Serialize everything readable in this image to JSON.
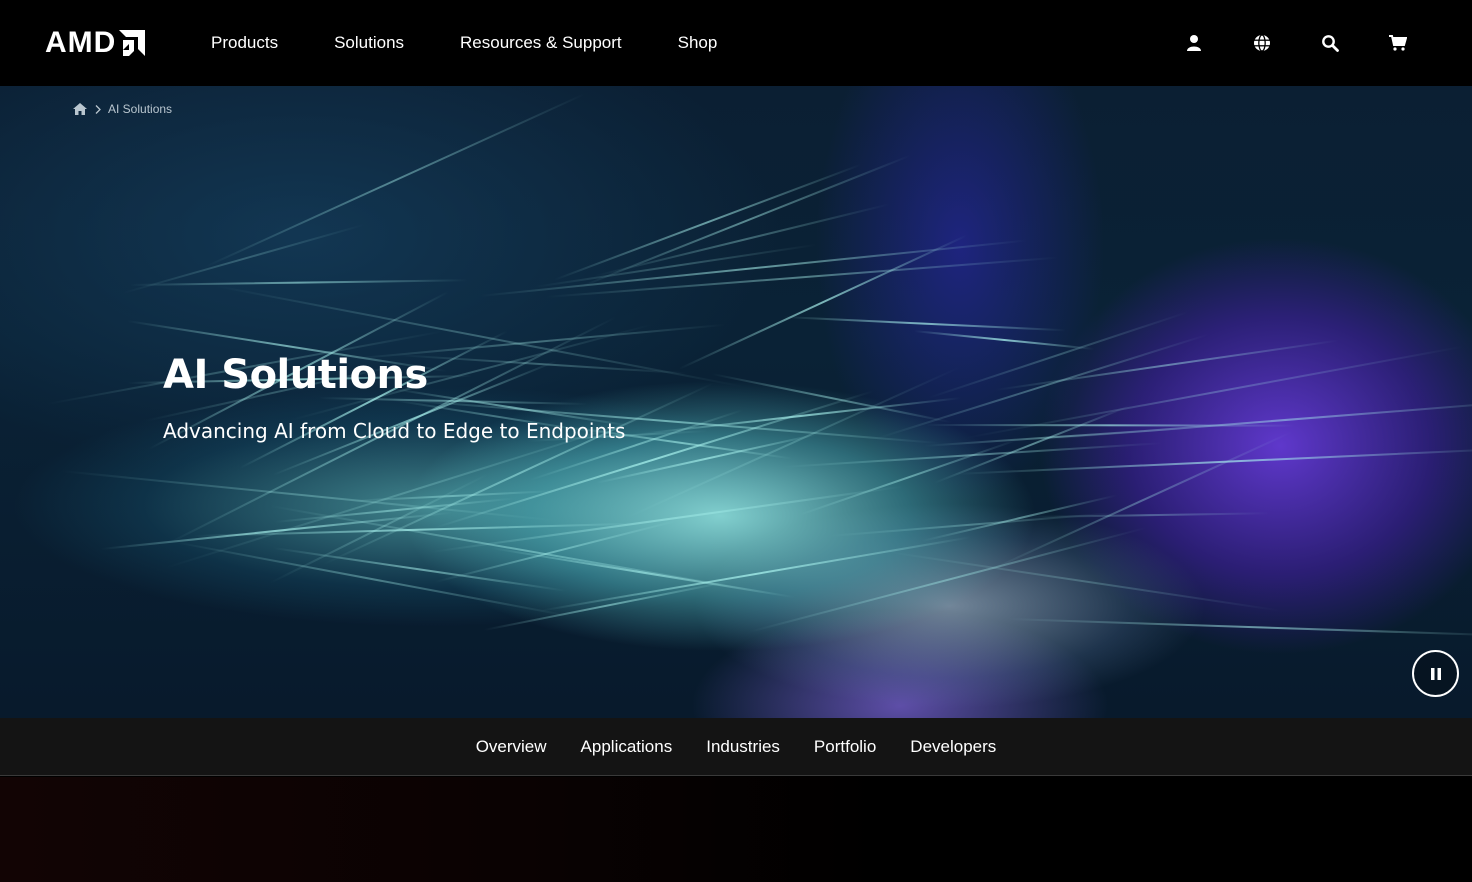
{
  "brand": {
    "logo_text": "AMD",
    "accent": "#ffffff"
  },
  "nav": {
    "links": [
      "Products",
      "Solutions",
      "Resources & Support",
      "Shop"
    ],
    "icons": [
      "user-icon",
      "globe-icon",
      "search-icon",
      "cart-icon"
    ]
  },
  "breadcrumb": {
    "home_icon": "home-icon",
    "current": "AI Solutions"
  },
  "hero": {
    "title": "AI Solutions",
    "subtitle": "Advancing AI from Cloud to Edge to Endpoints",
    "pause_icon": "pause-icon"
  },
  "subnav": {
    "links": [
      "Overview",
      "Applications",
      "Industries",
      "Portfolio",
      "Developers"
    ]
  },
  "colors": {
    "nav_background": "#000000",
    "subnav_background": "#141414",
    "hero_teal": "#7fe0dc",
    "hero_purple": "#5a2fd6"
  }
}
